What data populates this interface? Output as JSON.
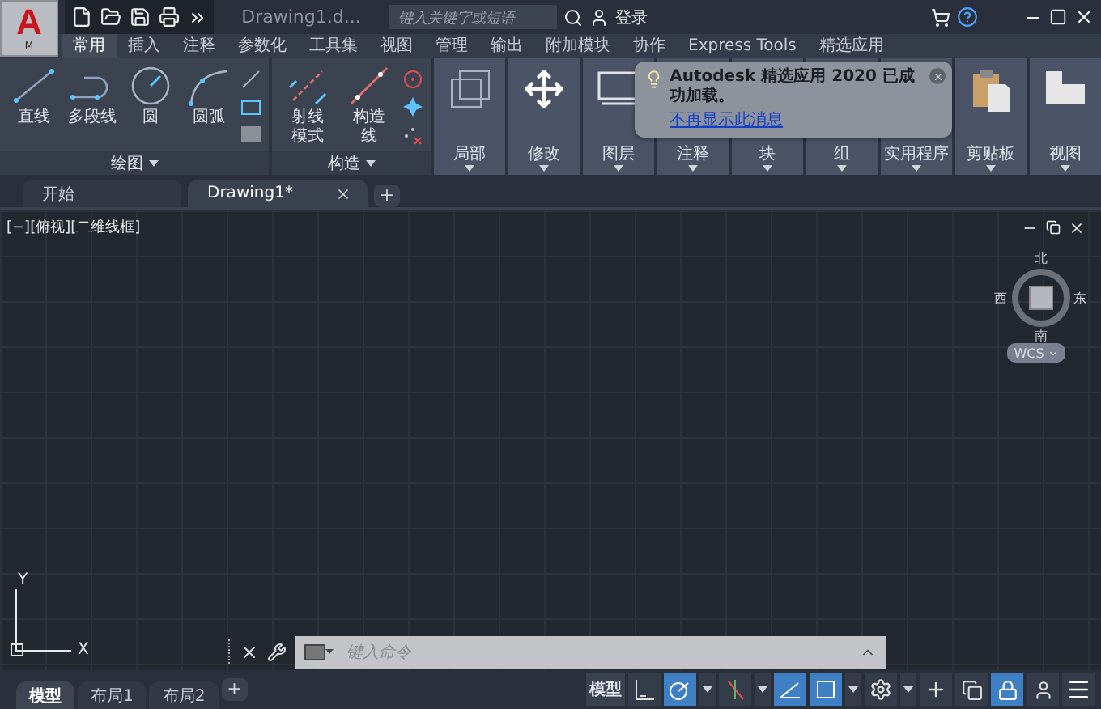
{
  "title_bar": {
    "logo": "A",
    "logo_badge": "M",
    "title": "Drawing1.d...",
    "search": {
      "placeholder": "键入关键字或短语"
    },
    "sign_in": "登录"
  },
  "ribbon_tabs": [
    {
      "label": "常用",
      "selected": true
    },
    {
      "label": "插入",
      "selected": false
    },
    {
      "label": "注释",
      "selected": false
    },
    {
      "label": "参数化",
      "selected": false
    },
    {
      "label": "工具集",
      "selected": false
    },
    {
      "label": "视图",
      "selected": false
    },
    {
      "label": "管理",
      "selected": false
    },
    {
      "label": "输出",
      "selected": false
    },
    {
      "label": "附加模块",
      "selected": false
    },
    {
      "label": "协作",
      "selected": false
    },
    {
      "label": "Express Tools",
      "selected": false
    },
    {
      "label": "精选应用",
      "selected": false
    }
  ],
  "ribbon": {
    "tool_panels": [
      {
        "label": "绘图",
        "tools": [
          {
            "kind": "line",
            "label": "直线"
          },
          {
            "kind": "polyline",
            "label": "多段线"
          },
          {
            "kind": "circle",
            "label": "圆"
          },
          {
            "kind": "arc",
            "label": "圆弧"
          }
        ],
        "small_tools": [
          {
            "kind": "line"
          },
          {
            "kind": "rect"
          },
          {
            "kind": "hatch"
          }
        ]
      },
      {
        "label": "构造",
        "tools": [
          {
            "kind": "ray",
            "label": "射线模式"
          },
          {
            "kind": "xline",
            "label": "构造线"
          }
        ],
        "small_tools": [
          {
            "kind": "target"
          },
          {
            "kind": "star"
          },
          {
            "kind": "points"
          }
        ]
      }
    ],
    "big_panels": [
      {
        "kind": "crop",
        "label": "局部"
      },
      {
        "kind": "move",
        "label": "修改"
      },
      {
        "kind": "layer",
        "label": "图层"
      },
      {
        "kind": "annotation",
        "label": "注释"
      },
      {
        "kind": "block",
        "label": "块"
      },
      {
        "kind": "group",
        "label": "组"
      },
      {
        "kind": "utility",
        "label": "实用程序"
      },
      {
        "kind": "clipboard",
        "label": "剪贴板"
      },
      {
        "kind": "view",
        "label": "视图"
      }
    ]
  },
  "notification": {
    "message": "Autodesk 精选应用 2020 已成功加载。",
    "link": "不再显示此消息"
  },
  "doc_tabs": [
    {
      "label": "开始",
      "selected": false,
      "closable": false
    },
    {
      "label": "Drawing1*",
      "selected": true,
      "closable": true
    }
  ],
  "doc_tab_add": "+",
  "viewport": {
    "label": "[−][俯视][二维线框]",
    "compass": {
      "north": "北",
      "south": "南",
      "east": "东",
      "west": "西"
    },
    "ucs_button": "WCS",
    "axis_x": "X",
    "axis_y": "Y"
  },
  "command_line": {
    "placeholder": "键入命令"
  },
  "layout_tabs": [
    {
      "label": "模型",
      "selected": true
    },
    {
      "label": "布局1",
      "selected": false
    },
    {
      "label": "布局2",
      "selected": false
    }
  ],
  "layout_tab_add": "+",
  "status_bar": {
    "space": "模型",
    "toggles": [
      {
        "kind": "grid",
        "on": false
      },
      {
        "kind": "snap",
        "on": true
      },
      {
        "kind": "caret",
        "on": false
      },
      {
        "kind": "iso",
        "on": false
      },
      {
        "kind": "caret",
        "on": false
      },
      {
        "kind": "polar",
        "on": true
      },
      {
        "kind": "osnap",
        "on": true
      },
      {
        "kind": "caret",
        "on": false
      },
      {
        "kind": "gear",
        "on": false
      },
      {
        "kind": "caret",
        "on": false
      },
      {
        "kind": "plus",
        "on": false
      },
      {
        "kind": "units",
        "on": false
      },
      {
        "kind": "lock",
        "on": true
      },
      {
        "kind": "people",
        "on": false
      },
      {
        "kind": "menu",
        "on": false
      }
    ]
  }
}
